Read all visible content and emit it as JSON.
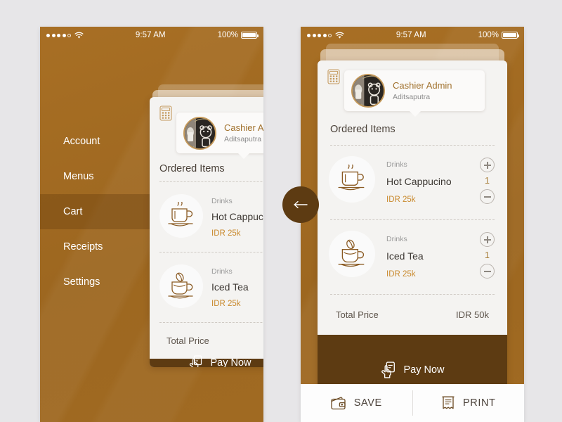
{
  "theme": {
    "page_bg": "#e7e6e8",
    "brand_brown": "#a06a22",
    "dark_brown": "#5d3b12",
    "accent_price": "#c98a2e",
    "card_bg": "#f4f3f1",
    "name_color": "#a0702b"
  },
  "status_bar": {
    "time": "9:57 AM",
    "battery_percent": "100%",
    "signal_icon": "signal-dots-icon",
    "wifi_icon": "wifi-icon",
    "battery_icon": "battery-full-icon"
  },
  "sidebar": {
    "items": [
      {
        "label": "Account",
        "active": false
      },
      {
        "label": "Menus",
        "active": false
      },
      {
        "label": "Cart",
        "active": true
      },
      {
        "label": "Receipts",
        "active": false
      },
      {
        "label": "Settings",
        "active": false
      }
    ]
  },
  "card": {
    "calculator_icon": "calculator-icon",
    "profile": {
      "name": "Cashier Admin",
      "username": "Aditsaputra",
      "avatar_icon": "avatar-bear-logo"
    },
    "section_title": "Ordered Items",
    "items": [
      {
        "category": "Drinks",
        "name": "Hot Cappucino",
        "price": "IDR 25k",
        "qty": "1",
        "icon": "hot-coffee-cup-icon",
        "plus_icon": "plus-circle-icon",
        "minus_icon": "minus-circle-icon"
      },
      {
        "category": "Drinks",
        "name": "Iced Tea",
        "price": "IDR 25k",
        "qty": "1",
        "icon": "coffee-bean-cup-icon",
        "plus_icon": "plus-circle-icon",
        "minus_icon": "minus-circle-icon"
      }
    ],
    "total": {
      "label": "Total Price",
      "value": "IDR 50k"
    },
    "pay": {
      "label": "Pay Now",
      "icon": "tap-to-pay-icon"
    }
  },
  "back_button": {
    "icon": "arrow-left-icon"
  },
  "bottom_bar": {
    "actions": [
      {
        "label": "SAVE",
        "icon": "wallet-icon"
      },
      {
        "label": "PRINT",
        "icon": "receipt-icon"
      }
    ]
  }
}
